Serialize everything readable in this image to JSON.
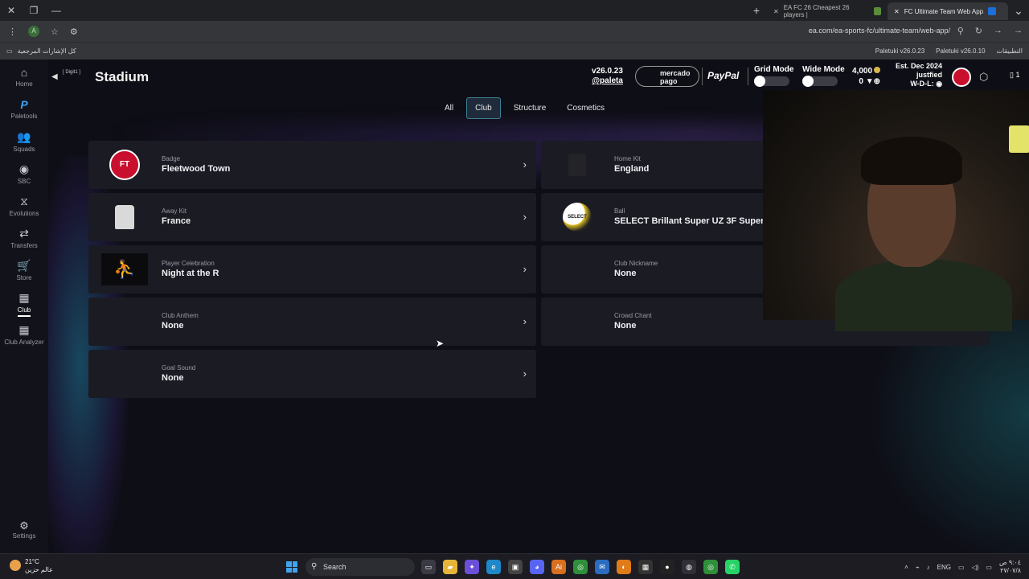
{
  "browser": {
    "tabs": [
      {
        "title": "EA FC 26 Cheapest 26 players |"
      },
      {
        "title": "FC Ultimate Team Web App"
      }
    ],
    "url": "ea.com/ea-sports-fc/ultimate-team/web-app/",
    "avatar_letter": "A",
    "bookmarks_left": "كل الإشارات المرجعية",
    "bookmarks_right": [
      {
        "label": "Paletuki v26.0.23"
      },
      {
        "label": "Paletuki v26.0.10"
      },
      {
        "label": "التطبيقات"
      }
    ]
  },
  "sidebar": {
    "items": [
      {
        "label": "Home",
        "icon": "home-icon",
        "glyph": "⌂"
      },
      {
        "label": "Paletools",
        "icon": "paletools-icon",
        "glyph": "P"
      },
      {
        "label": "Squads",
        "icon": "squads-icon",
        "glyph": "👥"
      },
      {
        "label": "SBC",
        "icon": "sbc-icon",
        "glyph": "◉"
      },
      {
        "label": "Evolutions",
        "icon": "evolutions-icon",
        "glyph": "⧖"
      },
      {
        "label": "Transfers",
        "icon": "transfers-icon",
        "glyph": "⇄"
      },
      {
        "label": "Store",
        "icon": "store-icon",
        "glyph": "🛒"
      },
      {
        "label": "Club",
        "icon": "club-icon",
        "glyph": "▦"
      },
      {
        "label": "Club Analyzer",
        "icon": "club-analyzer-icon",
        "glyph": "▦"
      }
    ],
    "active": "Club",
    "settings_label": "Settings"
  },
  "header": {
    "back_tag": "[ Digit1 ]",
    "title": "Stadium",
    "version": "v26.0.23",
    "handle": "@paleta",
    "mercado_pago": "mercado pago",
    "paypal": "PayPal",
    "grid_mode_label": "Grid Mode",
    "wide_mode_label": "Wide Mode",
    "coins": "4,000",
    "points": "0",
    "est": "Est. Dec 2024",
    "club_name": "justfied",
    "record": "W-D-L:",
    "device_count": "1"
  },
  "filters": [
    {
      "label": "All"
    },
    {
      "label": "Club"
    },
    {
      "label": "Structure"
    },
    {
      "label": "Cosmetics"
    }
  ],
  "active_filter": "Club",
  "items": [
    {
      "label": "Badge",
      "value": "Fleetwood Town"
    },
    {
      "label": "Home Kit",
      "value": "England"
    },
    {
      "label": "Away Kit",
      "value": "France"
    },
    {
      "label": "Ball",
      "value": "SELECT Brillant Super UZ 3F Superliga"
    },
    {
      "label": "Player Celebration",
      "value": "Night at the R"
    },
    {
      "label": "Club Nickname",
      "value": "None"
    },
    {
      "label": "Club Anthem",
      "value": "None"
    },
    {
      "label": "Crowd Chant",
      "value": "None"
    },
    {
      "label": "Goal Sound",
      "value": "None"
    }
  ],
  "badge_text": "FT",
  "ball_text": "SELECT",
  "taskbar": {
    "temperature": "21°C",
    "weather_text": "عالم حزين",
    "search_label": "Search",
    "lang": "ENG",
    "time": "٩:٠٤ ص",
    "date": "٢٧/٠٧/٨"
  },
  "colors": {
    "accent": "#3e7f97",
    "card_bg": "#1b1b24",
    "badge_red": "#c8102e"
  }
}
